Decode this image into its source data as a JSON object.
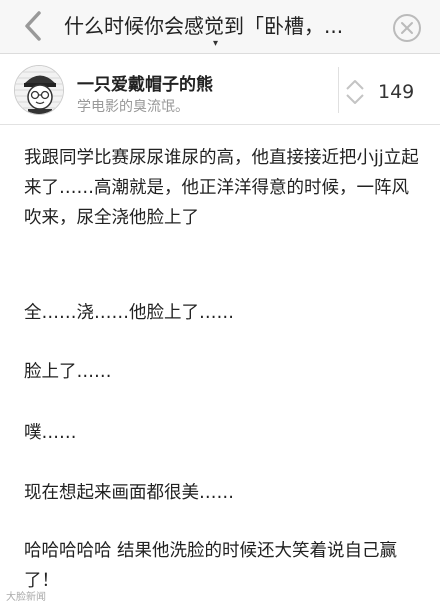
{
  "header": {
    "title": "什么时候你会感觉到「卧槽，...",
    "caret": "▾"
  },
  "author": {
    "name": "一只爱戴帽子的熊",
    "bio": "学电影的臭流氓。"
  },
  "votes": {
    "count": "149"
  },
  "answer": {
    "paragraphs": [
      "我跟同学比赛尿尿谁尿的高，他直接接近把小jj立起来了……高潮就是，他正洋洋得意的时候，一阵风吹来，尿全浇他脸上了",
      "全……浇……他脸上了……",
      "脸上了……",
      "噗……",
      "现在想起来画面都很美……",
      "哈哈哈哈哈 结果他洗脸的时候还大笑着说自己赢了！"
    ]
  },
  "watermark": {
    "text": "大脸新闻"
  },
  "colors": {
    "bar_bg": "#f7f7f7",
    "muted": "#999999",
    "text": "#222222"
  }
}
